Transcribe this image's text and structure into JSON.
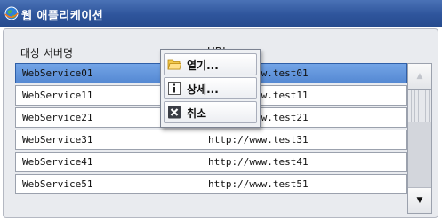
{
  "window": {
    "title": "웹 애플리케이션",
    "icon": "globe-icon"
  },
  "table": {
    "columns": {
      "server_name": "대상 서버명",
      "url": "URL"
    },
    "rows": [
      {
        "name": "WebService01",
        "url": "http://www.test01",
        "selected": true
      },
      {
        "name": "WebService11",
        "url": "http://www.test11"
      },
      {
        "name": "WebService21",
        "url": "http://www.test21"
      },
      {
        "name": "WebService31",
        "url": "http://www.test31"
      },
      {
        "name": "WebService41",
        "url": "http://www.test41"
      },
      {
        "name": "WebService51",
        "url": "http://www.test51"
      }
    ]
  },
  "scrollbar": {
    "up_icon": "triangle-up-icon",
    "down_icon": "triangle-down-icon"
  },
  "context_menu": {
    "items": [
      {
        "label": "열기...",
        "icon": "folder-icon"
      },
      {
        "label": "상세...",
        "icon": "info-icon"
      },
      {
        "label": "취소",
        "icon": "close-icon"
      }
    ]
  },
  "colors": {
    "titlebar": "#2f559c",
    "selected_row": "#5f92da"
  }
}
